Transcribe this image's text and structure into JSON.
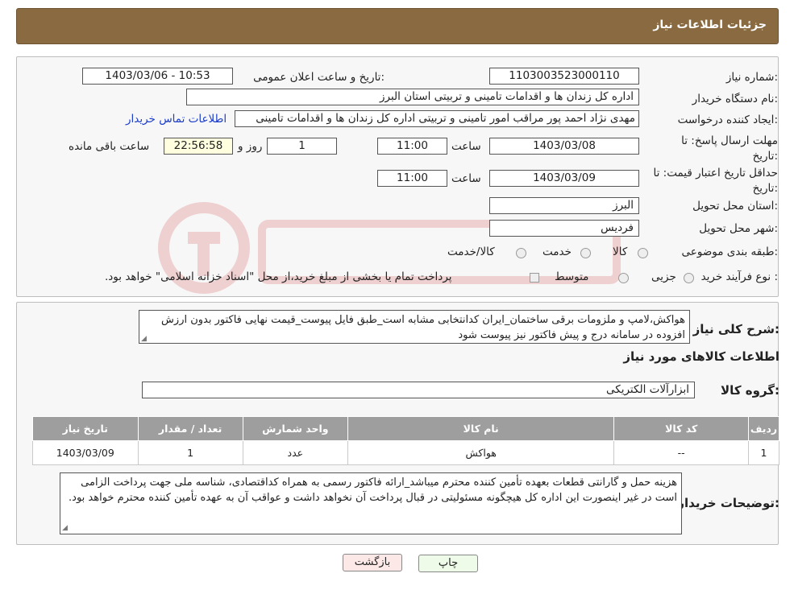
{
  "header": {
    "title": "جزئیات اطلاعات نیاز"
  },
  "info": {
    "need_number_label": "شماره نیاز:",
    "need_number": "1103003523000110",
    "announce_label": "تاریخ و ساعت اعلان عمومی:",
    "announce_value": "1403/03/06 - 10:53",
    "buyer_org_label": "نام دستگاه خریدار:",
    "buyer_org": "اداره کل زندان ها و اقدامات تامینی و تربیتی استان البرز",
    "creator_label": "ایجاد کننده درخواست:",
    "creator": "مهدی نژاد احمد پور مراقب امور تامینی و تربیتی اداره کل زندان ها و اقدامات تامینی",
    "contact_link": "اطلاعات تماس خریدار",
    "deadline_label": "مهلت ارسال پاسخ: تا تاریخ:",
    "deadline_date": "1403/03/08",
    "time_word": "ساعت",
    "deadline_time": "11:00",
    "days_value": "1",
    "days_word": "روز و",
    "remaining_time": "22:56:58",
    "remaining_label": "ساعت باقی مانده",
    "validity_label": "حداقل تاریخ اعتبار قیمت: تا تاریخ:",
    "validity_date": "1403/03/09",
    "validity_time": "11:00",
    "province_label": "استان محل تحویل:",
    "province": "البرز",
    "city_label": "شهر محل تحویل:",
    "city": "فردیس",
    "category_label": "طبقه بندی موضوعی:",
    "category_options": [
      "کالا",
      "خدمت",
      "کالا/خدمت"
    ],
    "process_label": "نوع فرآیند خرید :",
    "process_options": [
      "جزیی",
      "متوسط"
    ],
    "process_note": "پرداخت تمام یا بخشی از مبلغ خرید،از محل \"اسناد خزانه اسلامی\" خواهد بود."
  },
  "detail": {
    "summary_label": "شرح کلی نیاز:",
    "summary": "هواکش،لامپ و ملزومات برقی ساختمان_ایران کدانتخابی مشابه است_طبق فایل پیوست_قیمت نهایی فاکتور بدون ارزش افزوده در سامانه درج و پیش فاکتور نیز پیوست شود",
    "goods_title": "اطلاعات کالاهای مورد نیاز",
    "group_label": "گروه کالا:",
    "group_value": "ابزارآلات الکتریکی",
    "table": {
      "headers": [
        "ردیف",
        "کد کالا",
        "نام کالا",
        "واحد شمارش",
        "تعداد / مقدار",
        "تاریخ نیاز"
      ],
      "rows": [
        [
          "1",
          "--",
          "هواکش",
          "عدد",
          "1",
          "1403/03/09"
        ]
      ]
    },
    "buyer_notes_label": "توضیحات خریدار:",
    "buyer_notes": "هزینه حمل و گارانتی قطعات بعهده تأمین کننده محترم میباشد_ارائه فاکتور رسمی به همراه کداقتصادی، شناسه ملی جهت پرداخت الزامی است در غیر اینصورت این اداره کل هیچگونه مسئولیتی در قبال پرداخت آن نخواهد داشت و عواقب آن به عهده تأمین کننده محترم خواهد بود."
  },
  "buttons": {
    "print": "چاپ",
    "back": "بازگشت"
  },
  "colors": {
    "header_bg": "#8a6a40",
    "table_header_bg": "#9e9e9e",
    "back_button_bg": "#fde8e8",
    "print_button_bg": "#eefbe8",
    "link": "#1a3cc8"
  }
}
